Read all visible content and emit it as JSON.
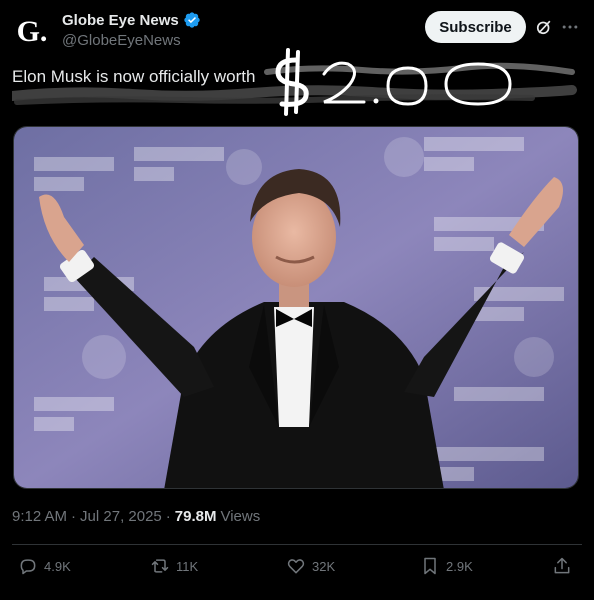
{
  "account": {
    "avatar_letter": "G.",
    "display_name": "Globe Eye News",
    "handle": "@GlobeEyeNews",
    "verified_color": "#1d9bf0"
  },
  "header": {
    "subscribe_label": "Subscribe",
    "icons": [
      "grok-icon",
      "more-icon"
    ]
  },
  "tweet": {
    "text": "Elon Musk is now officially worth",
    "handwritten_overlay": "$2.00"
  },
  "meta": {
    "time": "9:12 AM",
    "separator": "·",
    "date": "Jul 27, 2025",
    "views_count": "79.8M",
    "views_label": "Views"
  },
  "actions": {
    "replies": "4.9K",
    "reposts": "11K",
    "likes": "32K",
    "bookmarks": "2.9K"
  },
  "colors": {
    "background": "#000000",
    "text": "#e7e9ea",
    "muted": "#71767b",
    "border": "#2f3336"
  }
}
